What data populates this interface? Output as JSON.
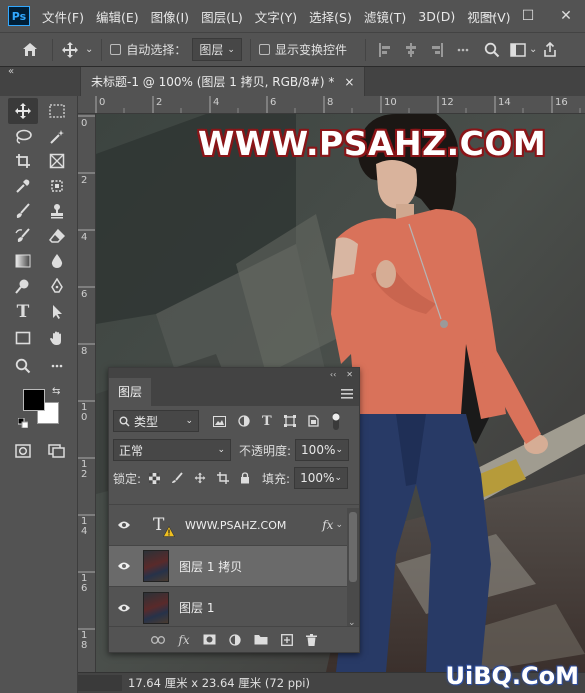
{
  "app": {
    "logo": "Ps"
  },
  "menu": [
    "文件(F)",
    "编辑(E)",
    "图像(I)",
    "图层(L)",
    "文字(Y)",
    "选择(S)",
    "滤镜(T)",
    "3D(D)",
    "视图(V)"
  ],
  "window_controls": [
    "—",
    "☐",
    "✕"
  ],
  "options": {
    "auto_select_label": "自动选择：",
    "auto_select_target": "图层",
    "show_transform_label": "显示变换控件"
  },
  "document": {
    "tab_title": "未标题-1 @ 100% (图层 1 拷贝, RGB/8#) *",
    "close_glyph": "×",
    "image_text": "WWW.PSAHZ.COM"
  },
  "rulers": {
    "top": [
      "0",
      "2",
      "4",
      "6",
      "8",
      "10",
      "12",
      "14",
      "16"
    ],
    "left": [
      "0",
      "2",
      "4",
      "6",
      "8",
      "1\n0",
      "1\n2",
      "1\n4",
      "1\n6",
      "1\n8"
    ]
  },
  "status": {
    "dimensions": "17.64 厘米 x 23.64 厘米 (72 ppi)"
  },
  "layers_panel": {
    "tab": "图层",
    "filter_kind": "类型",
    "blend_mode": "正常",
    "opacity_label": "不透明度:",
    "opacity_value": "100%",
    "lock_label": "锁定:",
    "fill_label": "填充:",
    "fill_value": "100%",
    "layers": [
      {
        "name": "WWW.PSAHZ.COM",
        "type": "text",
        "fx": "fx",
        "selected": false
      },
      {
        "name": "图层 1 拷贝",
        "type": "image",
        "selected": true
      },
      {
        "name": "图层 1",
        "type": "image",
        "selected": false
      }
    ]
  },
  "watermark": "UiBQ.CoM",
  "colors": {
    "accent": "#31a8ff",
    "image_text_fill": "#ffffff",
    "image_text_stroke": "#8a1518"
  }
}
